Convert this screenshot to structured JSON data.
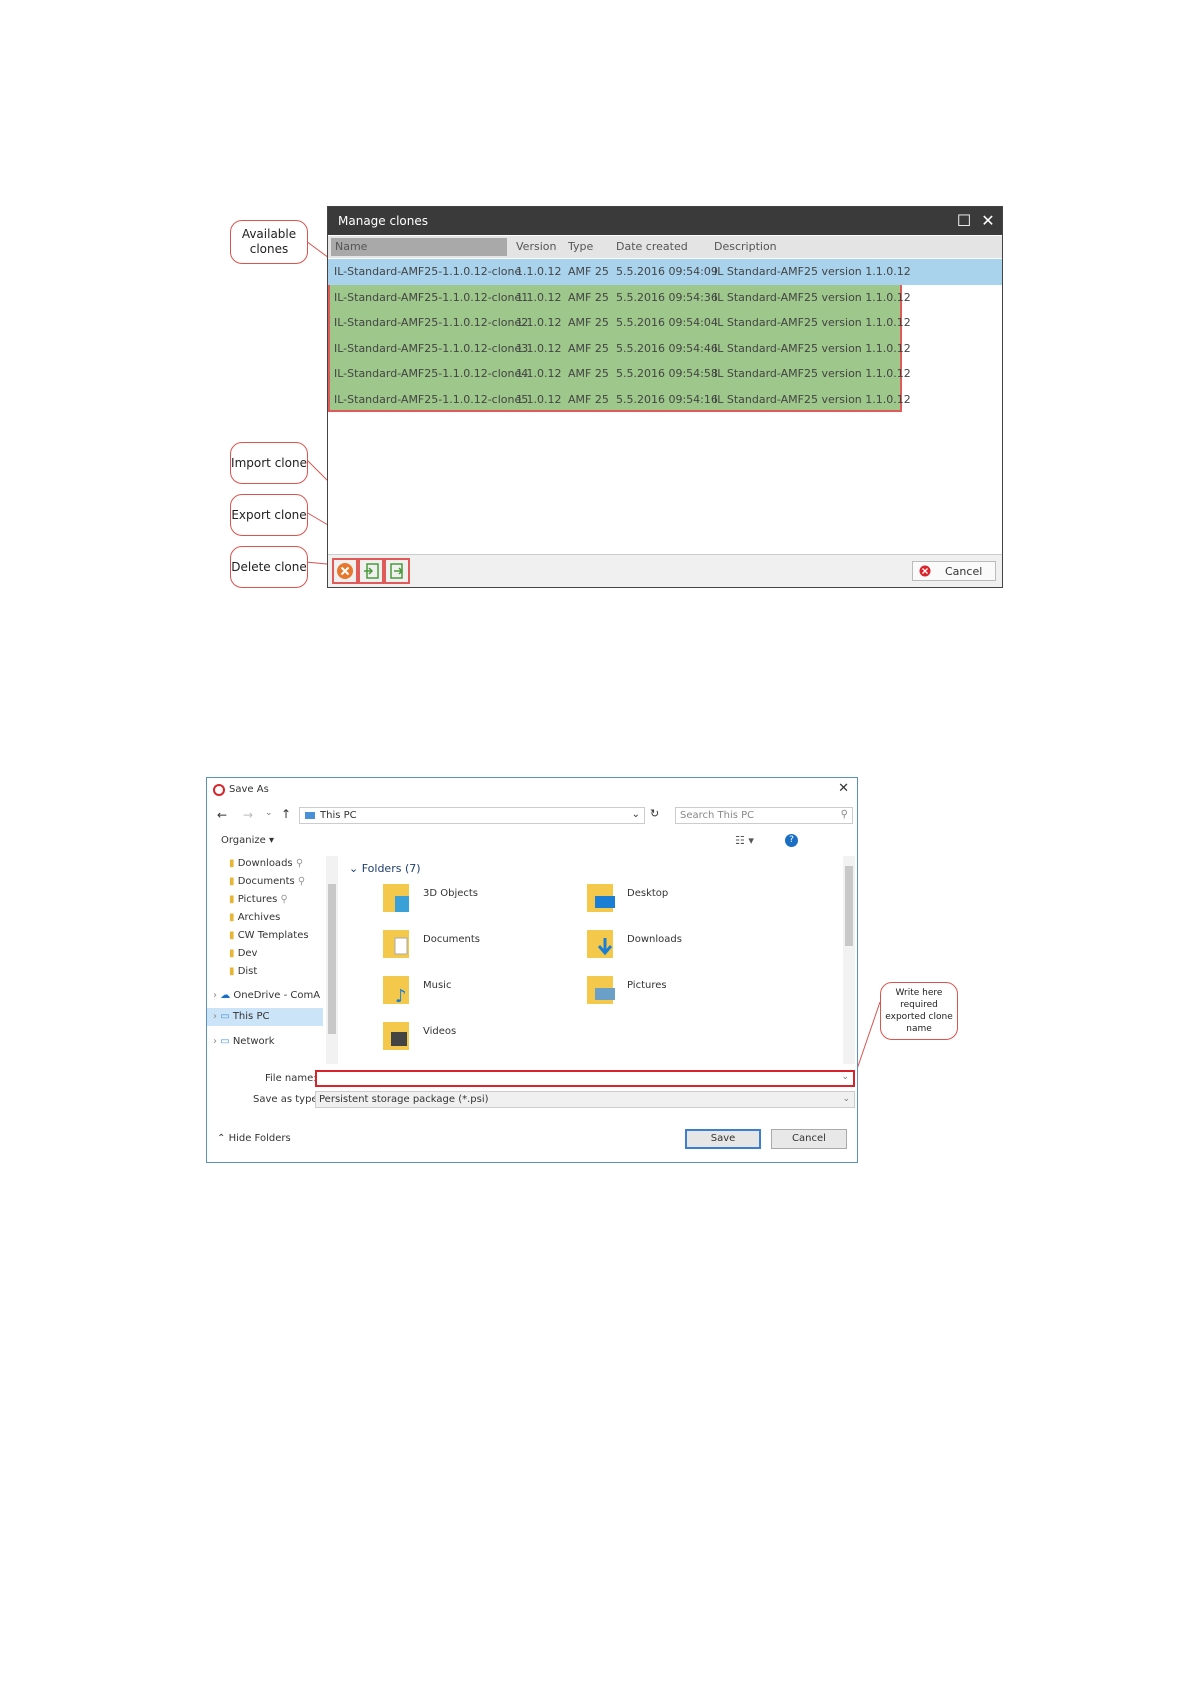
{
  "callouts": {
    "available": "Available clones",
    "import": "Import clone",
    "export": "Export clone",
    "delete": "Delete clone",
    "write_here": "Write here required exported clone name"
  },
  "manage_clones": {
    "title": "Manage clones",
    "columns": [
      "Name",
      "Version",
      "Type",
      "Date created",
      "Description"
    ],
    "rows": [
      [
        "IL-Standard-AMF25-1.1.0.12-clone",
        "1.1.0.12",
        "AMF 25",
        "5.5.2016 09:54:09",
        "IL Standard-AMF25 version 1.1.0.12"
      ],
      [
        "IL-Standard-AMF25-1.1.0.12-clone1",
        "1.1.0.12",
        "AMF 25",
        "5.5.2016 09:54:36",
        "IL Standard-AMF25 version 1.1.0.12"
      ],
      [
        "IL-Standard-AMF25-1.1.0.12-clone2",
        "1.1.0.12",
        "AMF 25",
        "5.5.2016 09:54:04",
        "IL Standard-AMF25 version 1.1.0.12"
      ],
      [
        "IL-Standard-AMF25-1.1.0.12-clone3",
        "1.1.0.12",
        "AMF 25",
        "5.5.2016 09:54:46",
        "IL Standard-AMF25 version 1.1.0.12"
      ],
      [
        "IL-Standard-AMF25-1.1.0.12-clone4",
        "1.1.0.12",
        "AMF 25",
        "5.5.2016 09:54:58",
        "IL Standard-AMF25 version 1.1.0.12"
      ],
      [
        "IL-Standard-AMF25-1.1.0.12-clone5",
        "1.1.0.12",
        "AMF 25",
        "5.5.2016 09:54:16",
        "IL Standard-AMF25 version 1.1.0.12"
      ]
    ],
    "cancel_label": "Cancel"
  },
  "save_as": {
    "title": "Save As",
    "address": "This PC",
    "search_placeholder": "Search This PC",
    "organize": "Organize ▾",
    "nav_items": [
      "Downloads",
      "Documents",
      "Pictures",
      "Archives",
      "CW Templates",
      "Dev",
      "Dist",
      "OneDrive - ComA",
      "This PC",
      "Network"
    ],
    "folders_header": "Folders (7)",
    "folders": [
      "3D Objects",
      "Desktop",
      "Documents",
      "Downloads",
      "Music",
      "Pictures",
      "Videos"
    ],
    "file_name_label": "File name:",
    "file_name_value": "",
    "save_type_label": "Save as type:",
    "save_type_value": "Persistent storage package (*.psi)",
    "hide_folders": "Hide Folders",
    "save_label": "Save",
    "cancel_label": "Cancel"
  }
}
